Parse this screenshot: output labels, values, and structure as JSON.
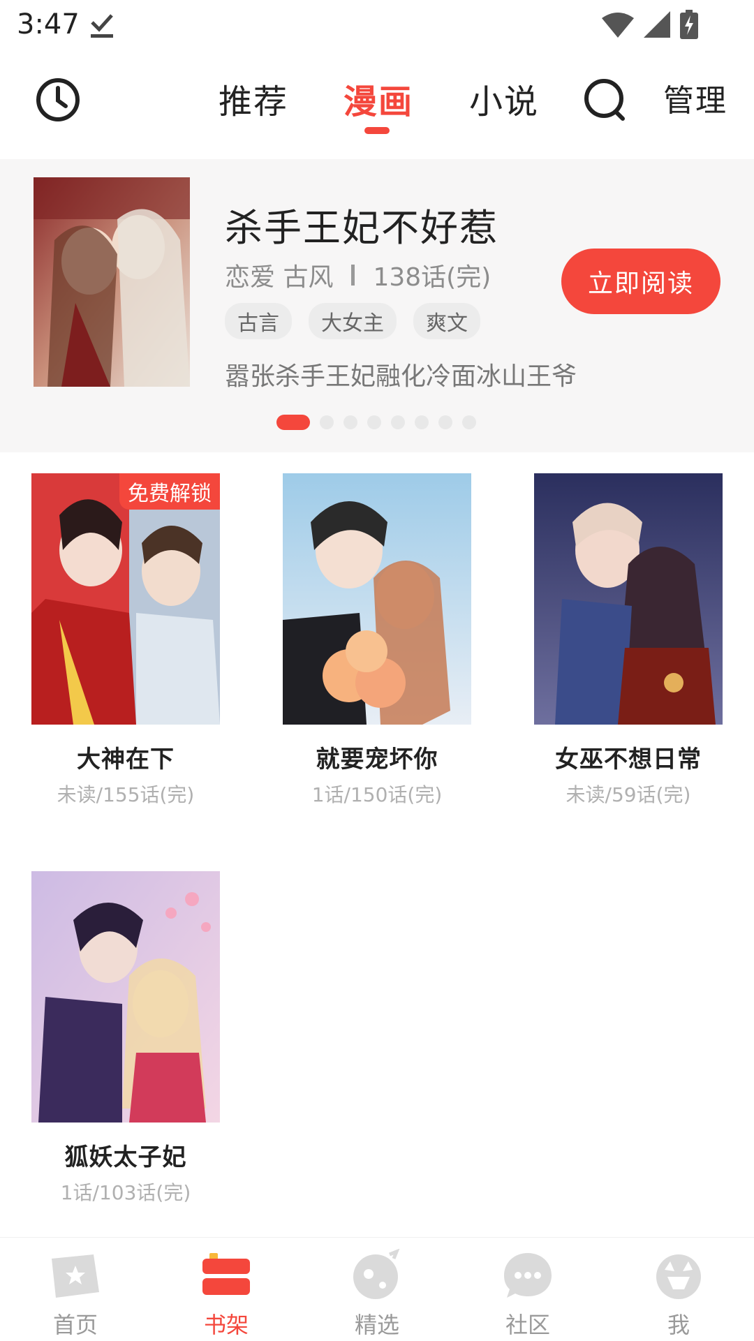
{
  "status_bar": {
    "time": "3:47"
  },
  "header": {
    "tabs": [
      {
        "label": "推荐",
        "active": false
      },
      {
        "label": "漫画",
        "active": true
      },
      {
        "label": "小说",
        "active": false
      }
    ],
    "manage_label": "管理",
    "accent_color": "#f4473c"
  },
  "featured": {
    "title": "杀手王妃不好惹",
    "genres": "恋爱 古风",
    "chapters": "138话(完)",
    "tags": [
      "古言",
      "大女主",
      "爽文"
    ],
    "description": "嚣张杀手王妃融化冷面冰山王爷",
    "read_button": "立即阅读",
    "carousel": {
      "count": 8,
      "active_index": 0
    }
  },
  "books": [
    {
      "title": "大神在下",
      "progress": "未读/155话(完)",
      "badge": "免费解锁"
    },
    {
      "title": "就要宠坏你",
      "progress": "1话/150话(完)",
      "badge": ""
    },
    {
      "title": "女巫不想日常",
      "progress": "未读/59话(完)",
      "badge": ""
    },
    {
      "title": "狐妖太子妃",
      "progress": "1话/103话(完)",
      "badge": ""
    }
  ],
  "bottom_nav": [
    {
      "label": "首页",
      "icon": "home-star-icon",
      "active": false
    },
    {
      "label": "书架",
      "icon": "bookshelf-icon",
      "active": true
    },
    {
      "label": "精选",
      "icon": "planet-icon",
      "active": false
    },
    {
      "label": "社区",
      "icon": "chat-bubble-icon",
      "active": false
    },
    {
      "label": "我",
      "icon": "profile-cat-icon",
      "active": false
    }
  ]
}
